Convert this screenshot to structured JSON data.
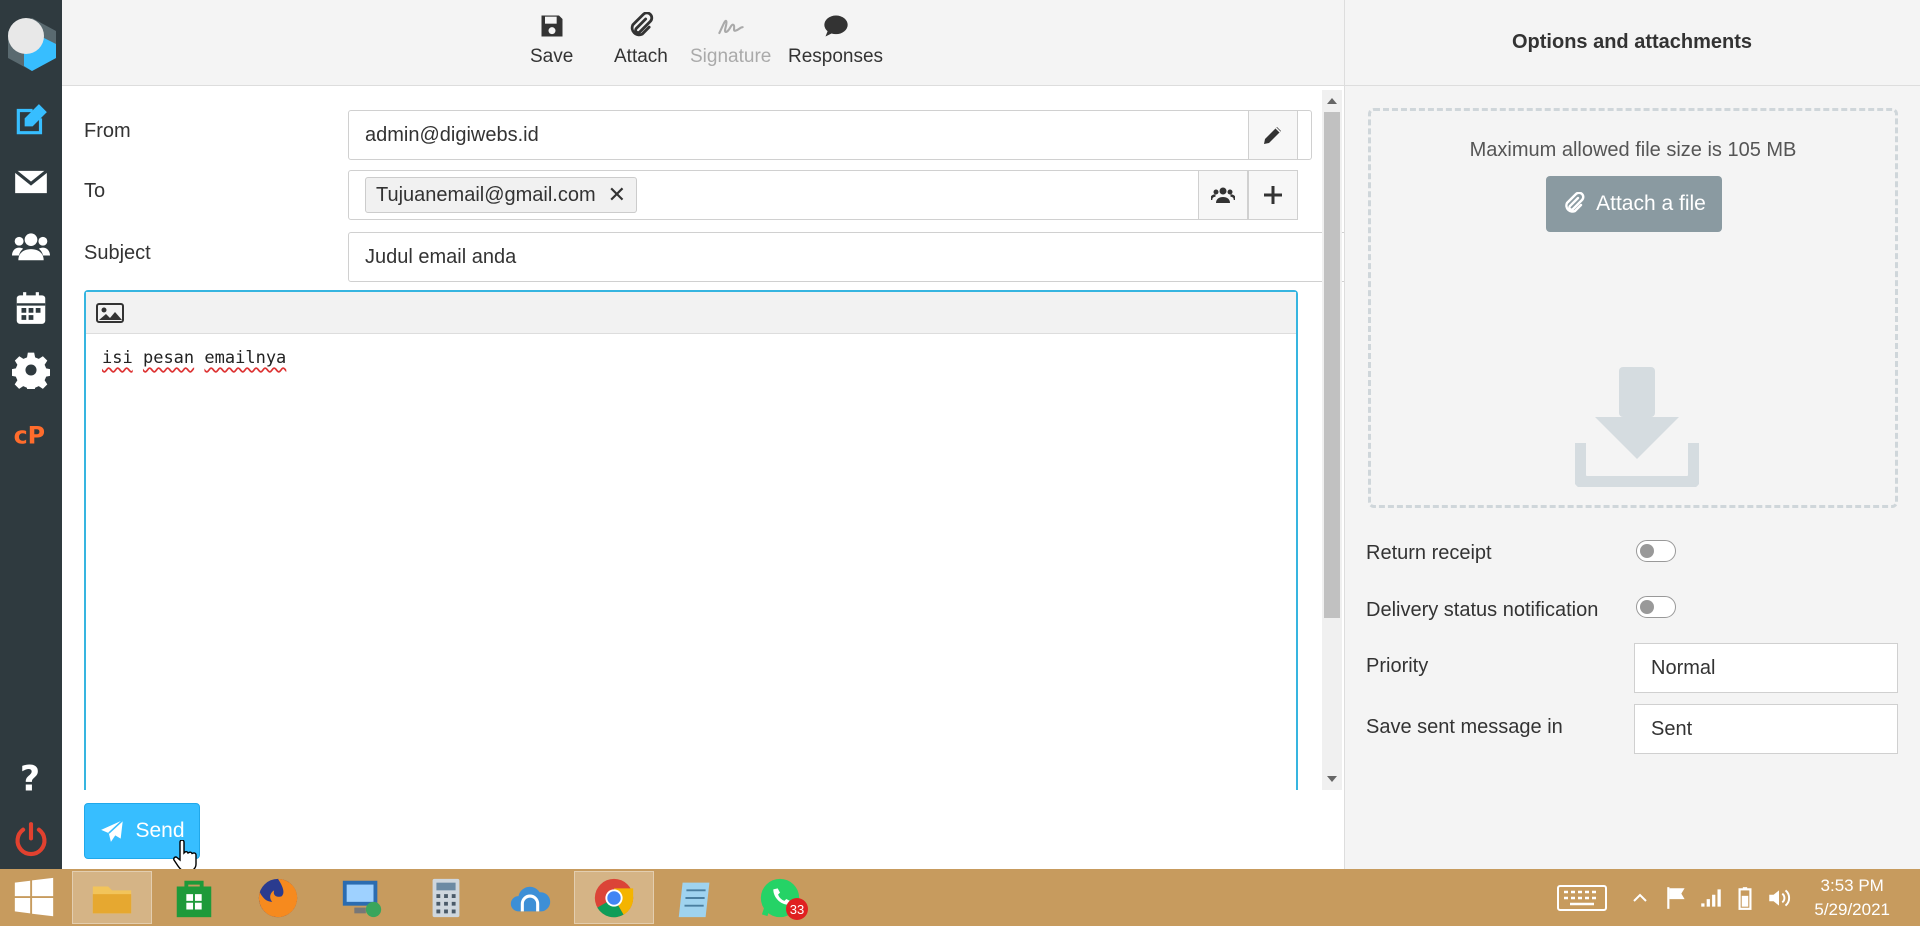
{
  "toolbar": {
    "save": "Save",
    "attach": "Attach",
    "signature": "Signature",
    "responses": "Responses"
  },
  "compose": {
    "from_label": "From",
    "from_value": "admin@digiwebs.id",
    "to_label": "To",
    "recipients": [
      "Tujuanemail@gmail.com"
    ],
    "subject_label": "Subject",
    "subject_value": "Judul email anda",
    "body_words": [
      "isi",
      "pesan",
      "emailnya"
    ],
    "send_label": "Send"
  },
  "options": {
    "header": "Options and attachments",
    "max_size_hint": "Maximum allowed file size is 105 MB",
    "attach_file_label": "Attach a file",
    "return_receipt_label": "Return receipt",
    "return_receipt_on": false,
    "dsn_label": "Delivery status notification",
    "dsn_on": false,
    "priority_label": "Priority",
    "priority_value": "Normal",
    "save_sent_label": "Save sent message in",
    "save_sent_value": "Sent"
  },
  "taskbar": {
    "whatsapp_badge": "33",
    "time": "3:53 PM",
    "date": "5/29/2021"
  },
  "colors": {
    "accent": "#37beff",
    "nav_bg": "#2f3a3f",
    "taskbar_bg": "#c79b5e",
    "compose_icon": "#37beff",
    "cpanel_icon": "#ff6c2c",
    "logout_icon": "#e2412f"
  }
}
